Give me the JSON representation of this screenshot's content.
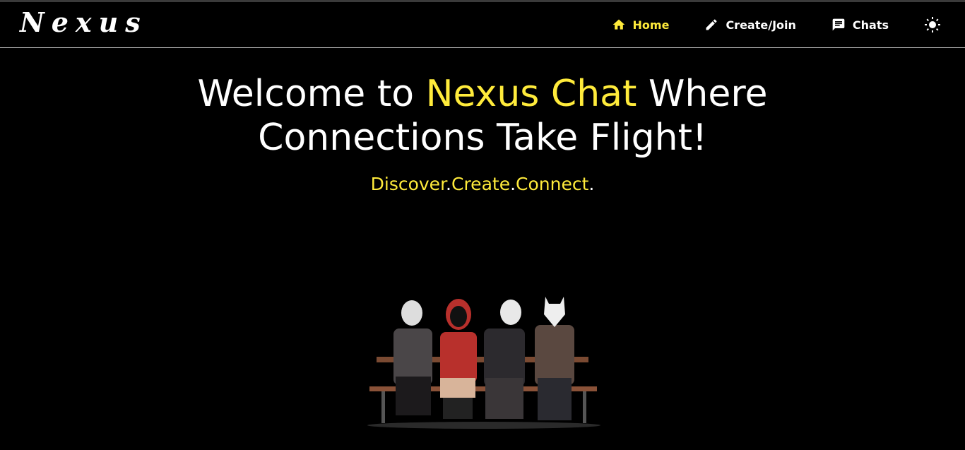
{
  "nav": {
    "logo": "Nexus",
    "items": [
      {
        "label": "Home",
        "icon": "home-icon",
        "active": true
      },
      {
        "label": "Create/Join",
        "icon": "pencil-icon"
      },
      {
        "label": "Chats",
        "icon": "chat-icon"
      }
    ],
    "theme_toggle_icon": "sun-icon"
  },
  "hero": {
    "title_pre": "Welcome to ",
    "title_highlight": "Nexus Chat",
    "title_post": " Where",
    "title_line2": "Connections Take Flight!",
    "tagline": [
      "Discover",
      ".",
      "Create",
      ".",
      "Connect",
      "."
    ]
  },
  "colors": {
    "accent": "#ffeb3b",
    "background": "#000000"
  }
}
